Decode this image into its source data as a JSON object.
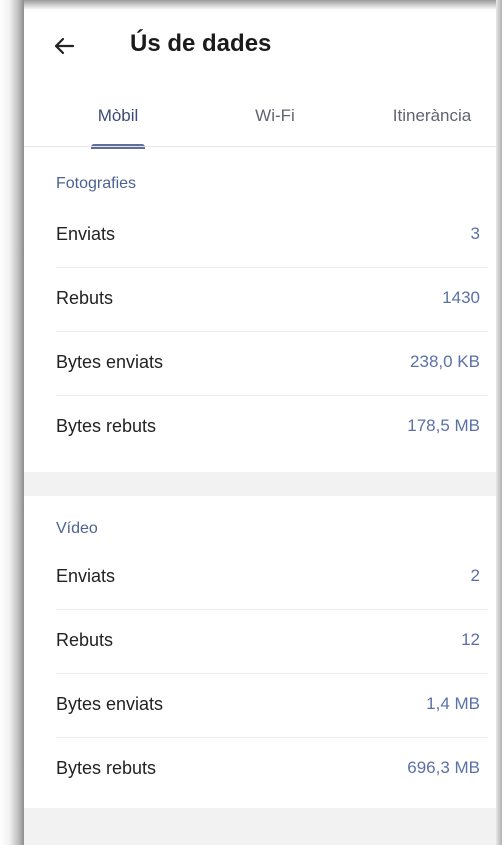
{
  "header": {
    "title": "Ús de dades"
  },
  "tabs": [
    {
      "label": "Mòbil",
      "active": true
    },
    {
      "label": "Wi-Fi",
      "active": false
    },
    {
      "label": "Itinerància",
      "active": false
    }
  ],
  "sections": [
    {
      "title": "Fotografies",
      "rows": [
        {
          "label": "Enviats",
          "value": "3"
        },
        {
          "label": "Rebuts",
          "value": "1430"
        },
        {
          "label": "Bytes enviats",
          "value": "238,0 KB"
        },
        {
          "label": "Bytes rebuts",
          "value": "178,5 MB"
        }
      ]
    },
    {
      "title": "Vídeo",
      "rows": [
        {
          "label": "Enviats",
          "value": "2"
        },
        {
          "label": "Rebuts",
          "value": "12"
        },
        {
          "label": "Bytes enviats",
          "value": "1,4 MB"
        },
        {
          "label": "Bytes rebuts",
          "value": "696,3 MB"
        }
      ]
    }
  ],
  "icons": {
    "back": "arrow-left-icon"
  },
  "colors": {
    "accent": "#5b71a6",
    "section_title": "#4d6291",
    "tab_indicator": "#5f6f9a",
    "section_gap": "#f2f2f2"
  }
}
